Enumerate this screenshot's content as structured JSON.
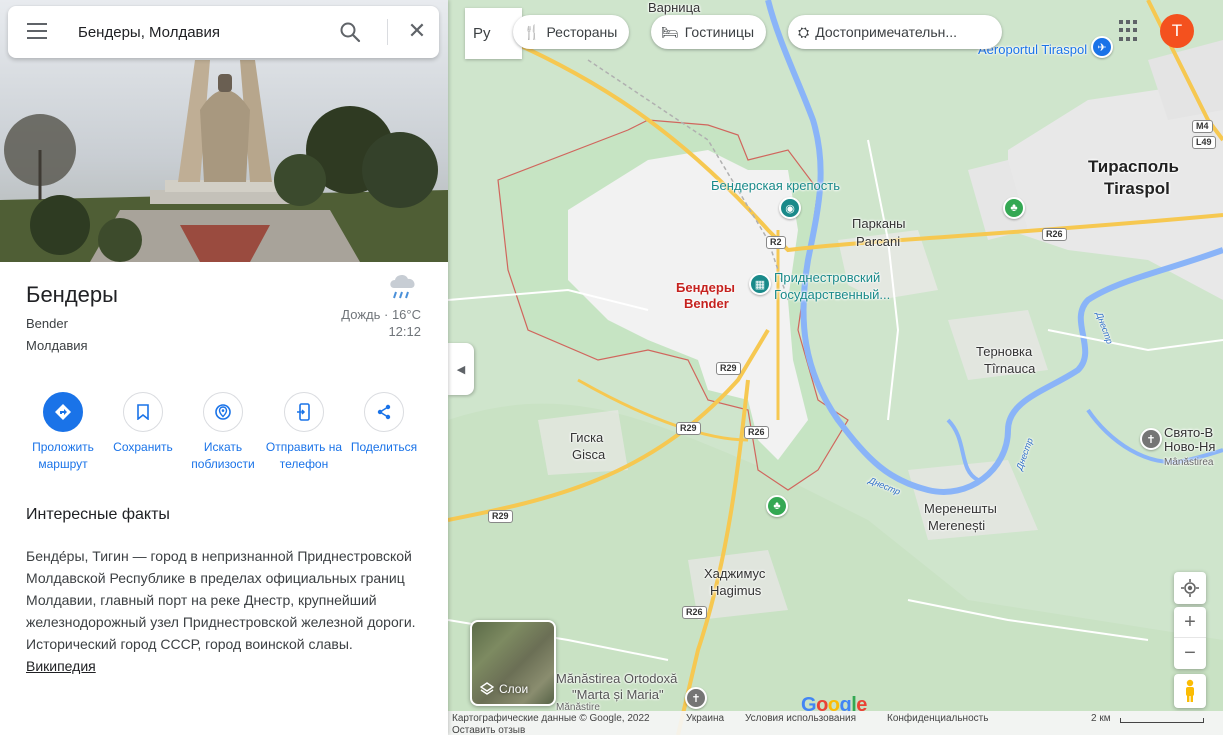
{
  "search": {
    "value": "Бендеры, Молдавия"
  },
  "place": {
    "title": "Бендеры",
    "subtitle_latin": "Bender",
    "country": "Молдавия"
  },
  "weather": {
    "condition": "Дождь",
    "temperature": "16°C",
    "time": "12:12",
    "icon": "rain-cloud-icon"
  },
  "actions": [
    {
      "label": "Проложить маршрут",
      "icon": "directions-icon"
    },
    {
      "label": "Сохранить",
      "icon": "bookmark-icon"
    },
    {
      "label": "Искать поблизости",
      "icon": "nearby-icon"
    },
    {
      "label": "Отправить на телефон",
      "icon": "send-to-phone-icon"
    },
    {
      "label": "Поделиться",
      "icon": "share-icon"
    }
  ],
  "facts": {
    "title": "Интересные факты",
    "text": "Бенде́ры, Тигин — город в непризнанной Приднестровской Молдавской Республике в пределах официальных границ Молдавии, главный порт на реке Днестр, крупнейший железнодорожный узел Приднестровской железной дороги. Исторический город СССР, город воинской славы.",
    "link": "Википедия"
  },
  "map": {
    "lang_button": "Ру",
    "chips": [
      {
        "label": "Рестораны",
        "icon": "restaurant-icon"
      },
      {
        "label": "Гостиницы",
        "icon": "hotel-icon"
      },
      {
        "label": "Достопримечательн...",
        "icon": "attraction-icon"
      }
    ],
    "avatar_letter": "T",
    "labels": {
      "varnitsa": "Варница",
      "airport": "Aeroportul Tiraspol",
      "tiraspol_ru": "Тирасполь",
      "tiraspol_ro": "Tiraspol",
      "fortress": "Бендерская крепость",
      "parkany_ru": "Парканы",
      "parkany_ro": "Parcani",
      "bender_ru": "Бендеры",
      "bender_ro": "Bender",
      "museum_1": "Приднестровский",
      "museum_2": "Государственный...",
      "ternovka_ru": "Терновка",
      "ternovka_ro": "Tîrnauca",
      "gisca_ru": "Гиска",
      "gisca_ro": "Gisca",
      "merenesti_ru": "Меренешты",
      "merenesti_ro": "Merenești",
      "hagimus_ru": "Хаджимус",
      "hagimus_ro": "Hagimus",
      "monastery_1": "Mănăstirea Ortodoxă",
      "monastery_2": "\"Marta și Maria\"",
      "monastery_3": "Mănăstire",
      "svyato_1": "Свято-В",
      "svyato_2": "Ново-Ня",
      "svyato_3": "Mânăstirea",
      "river": "Днестр"
    },
    "road_shields": [
      "R2",
      "R29",
      "R26",
      "R29",
      "R26",
      "R29",
      "R26",
      "M4",
      "L49"
    ],
    "layers_label": "Слои",
    "google_logo": "Google",
    "footer": {
      "copyright": "Картографические данные © Google, 2022",
      "region": "Украина",
      "terms": "Условия использования",
      "privacy": "Конфиденциальность",
      "scale": "2 км",
      "feedback": "Оставить отзыв"
    },
    "zoom_in": "+",
    "zoom_out": "−"
  },
  "colors": {
    "accent": "#1a73e8",
    "avatar": "#f4511e",
    "city_boundary": "#d0665d",
    "city_label": "#c5221f",
    "poi_teal": "#1a8a8a"
  }
}
